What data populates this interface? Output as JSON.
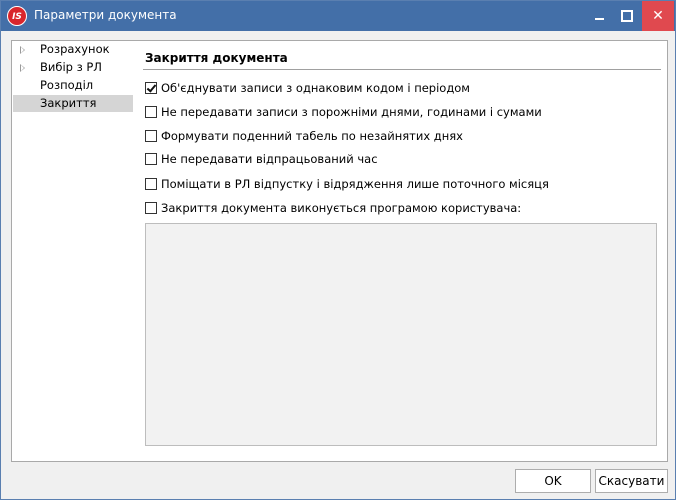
{
  "window": {
    "title": "Параметри документа",
    "app_icon_text": "IS"
  },
  "nav": {
    "items": [
      {
        "label": "Розрахунок",
        "has_arrow": true
      },
      {
        "label": "Вибір з РЛ",
        "has_arrow": true
      },
      {
        "label": "Розподіл",
        "has_arrow": false
      },
      {
        "label": "Закриття",
        "has_arrow": false,
        "selected": true
      }
    ]
  },
  "section": {
    "title": "Закриття документа",
    "options": [
      {
        "label": "Об'єднувати записи з однаковим кодом і періодом",
        "checked": true
      },
      {
        "label": "Не передавати записи з порожніми днями, годинами і сумами",
        "checked": false
      },
      {
        "label": "Формувати поденний табель по незайнятих днях",
        "checked": false
      },
      {
        "label": "Не передавати відпрацьований час",
        "checked": false
      },
      {
        "label": "Поміщати в РЛ відпустку і відрядження лише поточного місяця",
        "checked": false
      },
      {
        "label": "Закриття документа виконується програмою користувача:",
        "checked": false
      }
    ],
    "script_text": ""
  },
  "buttons": {
    "ok": "OK",
    "cancel": "Скасувати"
  }
}
